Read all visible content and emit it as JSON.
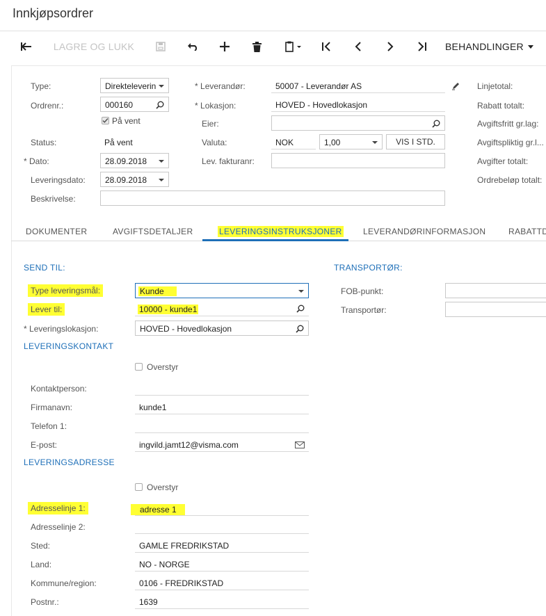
{
  "page": {
    "title": "Innkjøpsordrer"
  },
  "toolbar": {
    "save_close": "LAGRE OG LUKK",
    "actions_menu": "BEHANDLINGER"
  },
  "header": {
    "type": {
      "label": "Type:",
      "value": "Direkteleverin"
    },
    "order_no": {
      "label": "Ordrenr.:",
      "value": "000160"
    },
    "on_hold": {
      "label": "På vent",
      "checked": true
    },
    "status": {
      "label": "Status:",
      "value": "På vent"
    },
    "date": {
      "label": "Dato:",
      "value": "28.09.2018"
    },
    "delivery_date": {
      "label": "Leveringsdato:",
      "value": "28.09.2018"
    },
    "description": {
      "label": "Beskrivelse:",
      "value": ""
    },
    "supplier": {
      "label": "Leverandør:",
      "value": "50007 - Leverandør AS"
    },
    "location": {
      "label": "Lokasjon:",
      "value": "HOVED - Hovedlokasjon"
    },
    "owner": {
      "label": "Eier:",
      "value": ""
    },
    "currency": {
      "label": "Valuta:",
      "code": "NOK",
      "rate": "1,00",
      "button": "VIS I STD."
    },
    "supplier_invoice": {
      "label": "Lev. fakturanr:",
      "value": ""
    }
  },
  "totals": [
    "Linjetotal:",
    "Rabatt totalt:",
    "Avgiftsfritt gr.lag:",
    "Avgiftspliktig gr.l...",
    "Avgifter totalt:",
    "Ordrebeløp totalt:"
  ],
  "tabs": [
    {
      "label": "DOKUMENTER"
    },
    {
      "label": "AVGIFTSDETALJER"
    },
    {
      "label": "LEVERINGSINSTRUKSJONER"
    },
    {
      "label": "LEVERANDØRINFORMASJON"
    },
    {
      "label": "RABATTD"
    }
  ],
  "ship_to": {
    "section": "SEND TIL:",
    "dest_type": {
      "label": "Type leveringsmål:",
      "value": "Kunde"
    },
    "ship_to": {
      "label": "Lever til:",
      "value": "10000 - kunde1"
    },
    "ship_location": {
      "label": "Leveringslokasjon:",
      "value": "HOVED - Hovedlokasjon"
    }
  },
  "contact": {
    "section": "LEVERINGSKONTAKT",
    "override": "Overstyr",
    "contact_person": {
      "label": "Kontaktperson:",
      "value": ""
    },
    "company": {
      "label": "Firmanavn:",
      "value": "kunde1"
    },
    "phone": {
      "label": "Telefon 1:",
      "value": ""
    },
    "email": {
      "label": "E-post:",
      "value": "ingvild.jamt12@visma.com"
    }
  },
  "address": {
    "section": "LEVERINGSADRESSE",
    "override": "Overstyr",
    "line1": {
      "label": "Adresselinje 1:",
      "value": "adresse 1"
    },
    "line2": {
      "label": "Adresselinje 2:",
      "value": ""
    },
    "city": {
      "label": "Sted:",
      "value": "GAMLE FREDRIKSTAD"
    },
    "country": {
      "label": "Land:",
      "value": "NO - NORGE"
    },
    "county": {
      "label": "Kommune/region:",
      "value": "0106 - FREDRIKSTAD"
    },
    "postcode": {
      "label": "Postnr.:",
      "value": "1639"
    }
  },
  "carrier": {
    "section": "TRANSPORTØR:",
    "fob": {
      "label": "FOB-punkt:",
      "value": ""
    },
    "carrier": {
      "label": "Transportør:",
      "value": ""
    }
  },
  "colors": {
    "accent": "#1e6fb8",
    "highlight": "#ffff33"
  }
}
